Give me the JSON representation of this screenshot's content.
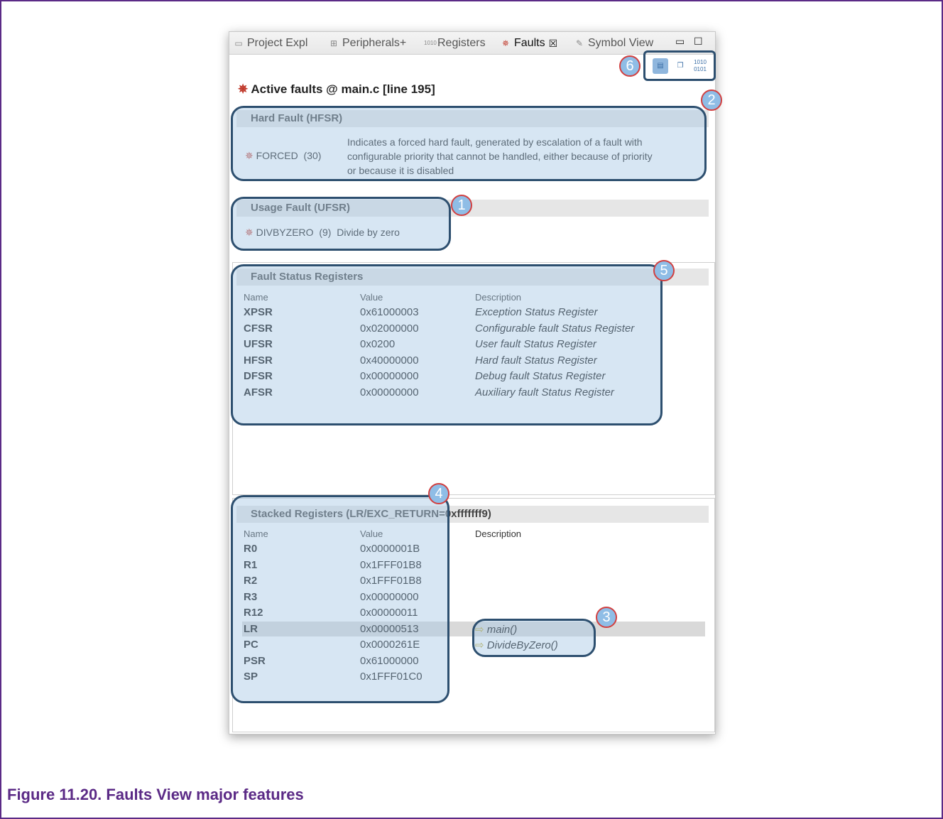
{
  "tabs": [
    {
      "label": "Project Expl",
      "icon": "folder-icon"
    },
    {
      "label": "Peripherals+",
      "icon": "peripherals-icon"
    },
    {
      "label": "Registers",
      "icon": "registers-icon"
    },
    {
      "label": "Faults",
      "icon": "bug-icon",
      "close": "☒"
    },
    {
      "label": "Symbol View",
      "icon": "symbol-icon"
    }
  ],
  "toolbar": {
    "buttons": [
      "show-in-source-icon",
      "copy-icon",
      "binary-view-icon"
    ]
  },
  "header": {
    "title": "Active faults @ main.c [line 195]"
  },
  "hard_fault": {
    "title": "Hard Fault (HFSR)",
    "flag": "FORCED",
    "code": "(30)",
    "description_lines": [
      "Indicates a forced hard fault, generated by escalation of a fault with",
      "configurable priority that cannot be handled, either because of priority",
      "or because it is disabled"
    ]
  },
  "usage_fault": {
    "title": "Usage Fault (UFSR)",
    "flag": "DIVBYZERO",
    "code": "(9)",
    "description": "Divide by zero"
  },
  "fault_status": {
    "title": "Fault Status Registers",
    "columns": [
      "Name",
      "Value",
      "Description"
    ],
    "rows": [
      {
        "name": "XPSR",
        "value": "0x61000003",
        "desc": "Exception Status Register"
      },
      {
        "name": "CFSR",
        "value": "0x02000000",
        "desc": "Configurable fault Status Register"
      },
      {
        "name": "UFSR",
        "value": "0x0200",
        "desc": "User fault Status Register"
      },
      {
        "name": "HFSR",
        "value": "0x40000000",
        "desc": "Hard fault Status Register"
      },
      {
        "name": "DFSR",
        "value": "0x00000000",
        "desc": "Debug fault Status Register"
      },
      {
        "name": "AFSR",
        "value": "0x00000000",
        "desc": "Auxiliary fault Status Register"
      }
    ]
  },
  "stacked": {
    "title": "Stacked Registers (LR/EXC_RETURN=0xfffffff9)",
    "columns": [
      "Name",
      "Value",
      "Description"
    ],
    "rows": [
      {
        "name": "R0",
        "value": "0x0000001B",
        "desc": ""
      },
      {
        "name": "R1",
        "value": "0x1FFF01B8",
        "desc": ""
      },
      {
        "name": "R2",
        "value": "0x1FFF01B8",
        "desc": ""
      },
      {
        "name": "R3",
        "value": "0x00000000",
        "desc": ""
      },
      {
        "name": "R12",
        "value": "0x00000011",
        "desc": ""
      },
      {
        "name": "LR",
        "value": "0x00000513",
        "desc": "main()"
      },
      {
        "name": "PC",
        "value": "0x0000261E",
        "desc": "DivideByZero()"
      },
      {
        "name": "PSR",
        "value": "0x61000000",
        "desc": ""
      },
      {
        "name": "SP",
        "value": "0x1FFF01C0",
        "desc": ""
      }
    ]
  },
  "callouts": [
    "1",
    "2",
    "3",
    "4",
    "5",
    "6"
  ],
  "caption": "Figure 11.20. Faults View major features",
  "colors": {
    "callout_border": "#2d4f6f",
    "callout_fill": "#a6c8e4",
    "badge_ring": "#d24040",
    "caption": "#5b2a86"
  }
}
